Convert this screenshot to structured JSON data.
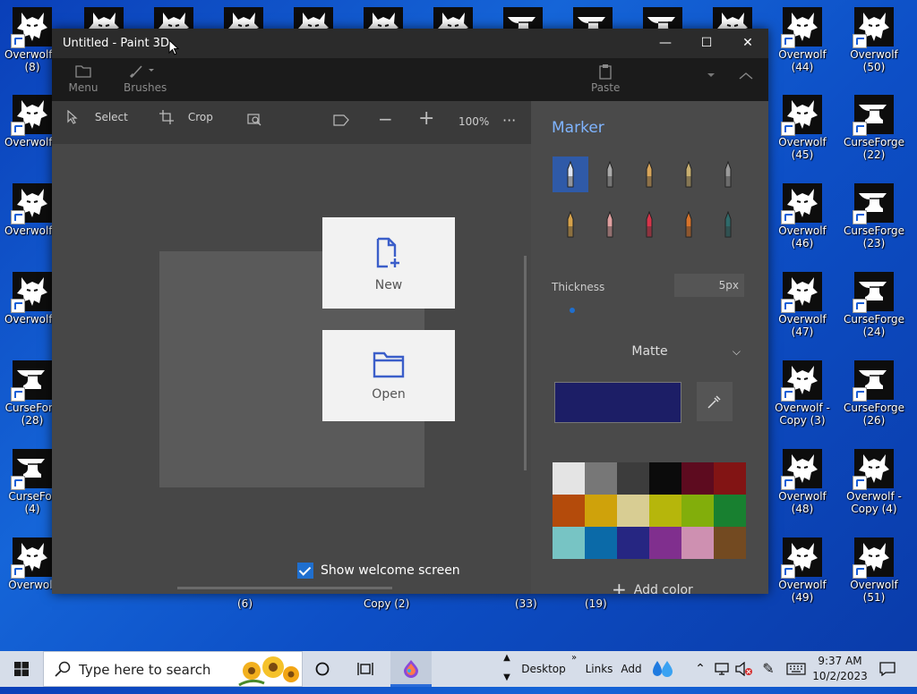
{
  "desktop": {
    "icons": [
      {
        "label": "Overwolf (50)",
        "kind": "wolf"
      },
      {
        "label": "Overwolf (44)",
        "kind": "wolf"
      },
      {
        "label": "Overwolf (45)",
        "kind": "wolf"
      },
      {
        "label": "CurseForge (22)",
        "kind": "anvil"
      },
      {
        "label": "Overwolf (46)",
        "kind": "wolf"
      },
      {
        "label": "CurseForge (23)",
        "kind": "anvil"
      },
      {
        "label": "Overwolf (47)",
        "kind": "wolf"
      },
      {
        "label": "CurseForge (24)",
        "kind": "anvil"
      },
      {
        "label": "Overwolf - Copy (3)",
        "kind": "wolf"
      },
      {
        "label": "CurseForge (26)",
        "kind": "anvil"
      },
      {
        "label": "Overwolf (48)",
        "kind": "wolf"
      },
      {
        "label": "Overwolf - Copy (4)",
        "kind": "wolf"
      },
      {
        "label": "Overwolf (49)",
        "kind": "wolf"
      },
      {
        "label": "Overwolf (51)",
        "kind": "wolf"
      }
    ],
    "left_icons": [
      {
        "label": "Overwolf (",
        "sub": "(8)",
        "kind": "wolf"
      },
      {
        "label": "Overwolf (",
        "kind": "wolf"
      },
      {
        "label": "Overwolf (",
        "kind": "wolf"
      },
      {
        "label": "Overwolf (",
        "kind": "wolf"
      },
      {
        "label": "CurseForg",
        "sub": "(28)",
        "kind": "anvil"
      },
      {
        "label": "CurseFor",
        "sub": "(4)",
        "kind": "anvil"
      },
      {
        "label": "Overwolf",
        "kind": "wolf"
      }
    ],
    "partial_labels": [
      "(6)",
      "Copy (2)",
      "(33)",
      "(19)"
    ],
    "wolf_color": "#ffffff",
    "icon_bg": "#0d0d0d"
  },
  "window": {
    "title": "Untitled - Paint 3D",
    "controls": {
      "minimize": "—",
      "maximize": "☐",
      "close": "✕"
    },
    "ribbon": {
      "menu": "Menu",
      "brushes": "Brushes",
      "paste": "Paste",
      "more": "…"
    },
    "toolbar": {
      "select": "Select",
      "crop": "Crop",
      "zoom": "100%",
      "more": "···"
    },
    "welcome": {
      "new": "New",
      "open": "Open",
      "show_welcome": "Show welcome screen"
    },
    "panel": {
      "title": "Marker",
      "thickness_label": "Thickness",
      "thickness_value": "5px",
      "thickness_level": 0.05,
      "finish": "Matte",
      "selected_color": "#1c1e66",
      "add_color": "Add color",
      "palette": [
        "#ffffff",
        "#7f7f7f",
        "#3a3a3a",
        "#000000",
        "#600018",
        "#8c0a0a",
        "#c74b00",
        "#e6b200",
        "#f1e4a0",
        "#c9c900",
        "#8cbf00",
        "#0f8a2c",
        "#7fd9d9",
        "#0070b8",
        "#20208c",
        "#8a2a9a",
        "#e59cc3",
        "#7a4a1a"
      ],
      "brushes": [
        "marker",
        "calligraphy-pen",
        "oil-brush",
        "watercolor",
        "pixel-pen",
        "pencil",
        "eraser",
        "crayon",
        "spray-can",
        "fill"
      ]
    }
  },
  "taskbar": {
    "search_placeholder": "Type here to search",
    "desktop": "Desktop",
    "links": "Links",
    "add": "Add",
    "time": "9:37 AM",
    "date": "10/2/2023"
  }
}
